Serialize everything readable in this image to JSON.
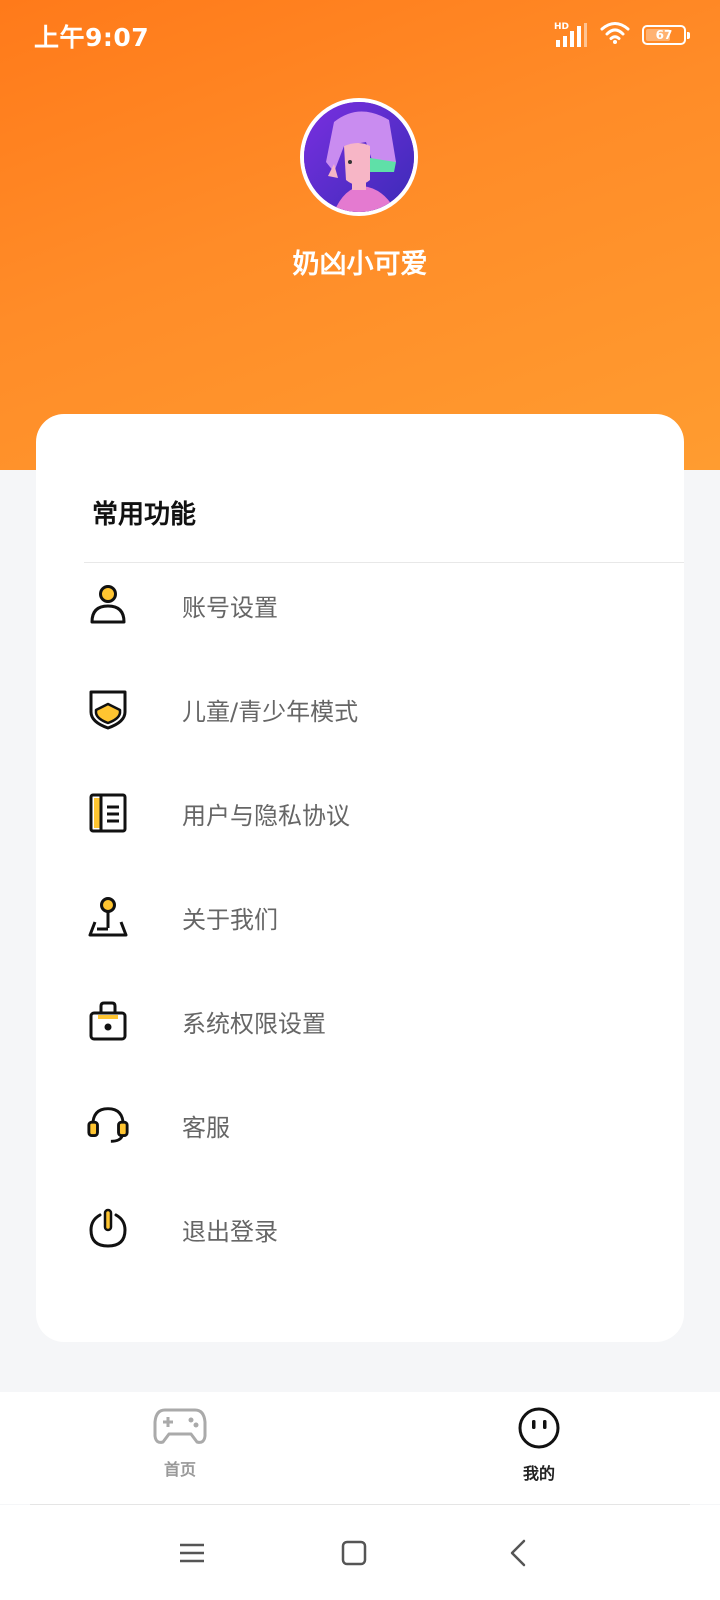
{
  "status_bar": {
    "time": "上午9:07",
    "battery": "67",
    "battery_level": 0.67,
    "signal_label": "HD"
  },
  "profile": {
    "username": "奶凶小可爱"
  },
  "card": {
    "section_title": "常用功能",
    "items": [
      {
        "label": "账号设置",
        "icon": "person-icon"
      },
      {
        "label": "儿童/青少年模式",
        "icon": "shield-icon"
      },
      {
        "label": "用户与隐私协议",
        "icon": "document-icon"
      },
      {
        "label": "关于我们",
        "icon": "map-pin-icon"
      },
      {
        "label": "系统权限设置",
        "icon": "lock-bag-icon"
      },
      {
        "label": "客服",
        "icon": "headset-icon"
      },
      {
        "label": "退出登录",
        "icon": "power-icon"
      }
    ]
  },
  "bottom_nav": {
    "items": [
      {
        "label": "首页",
        "icon": "gamepad-icon",
        "active": false
      },
      {
        "label": "我的",
        "icon": "face-icon",
        "active": true
      }
    ]
  },
  "colors": {
    "accent": "#ff7a1a",
    "icon_yellow": "#ffc531"
  }
}
